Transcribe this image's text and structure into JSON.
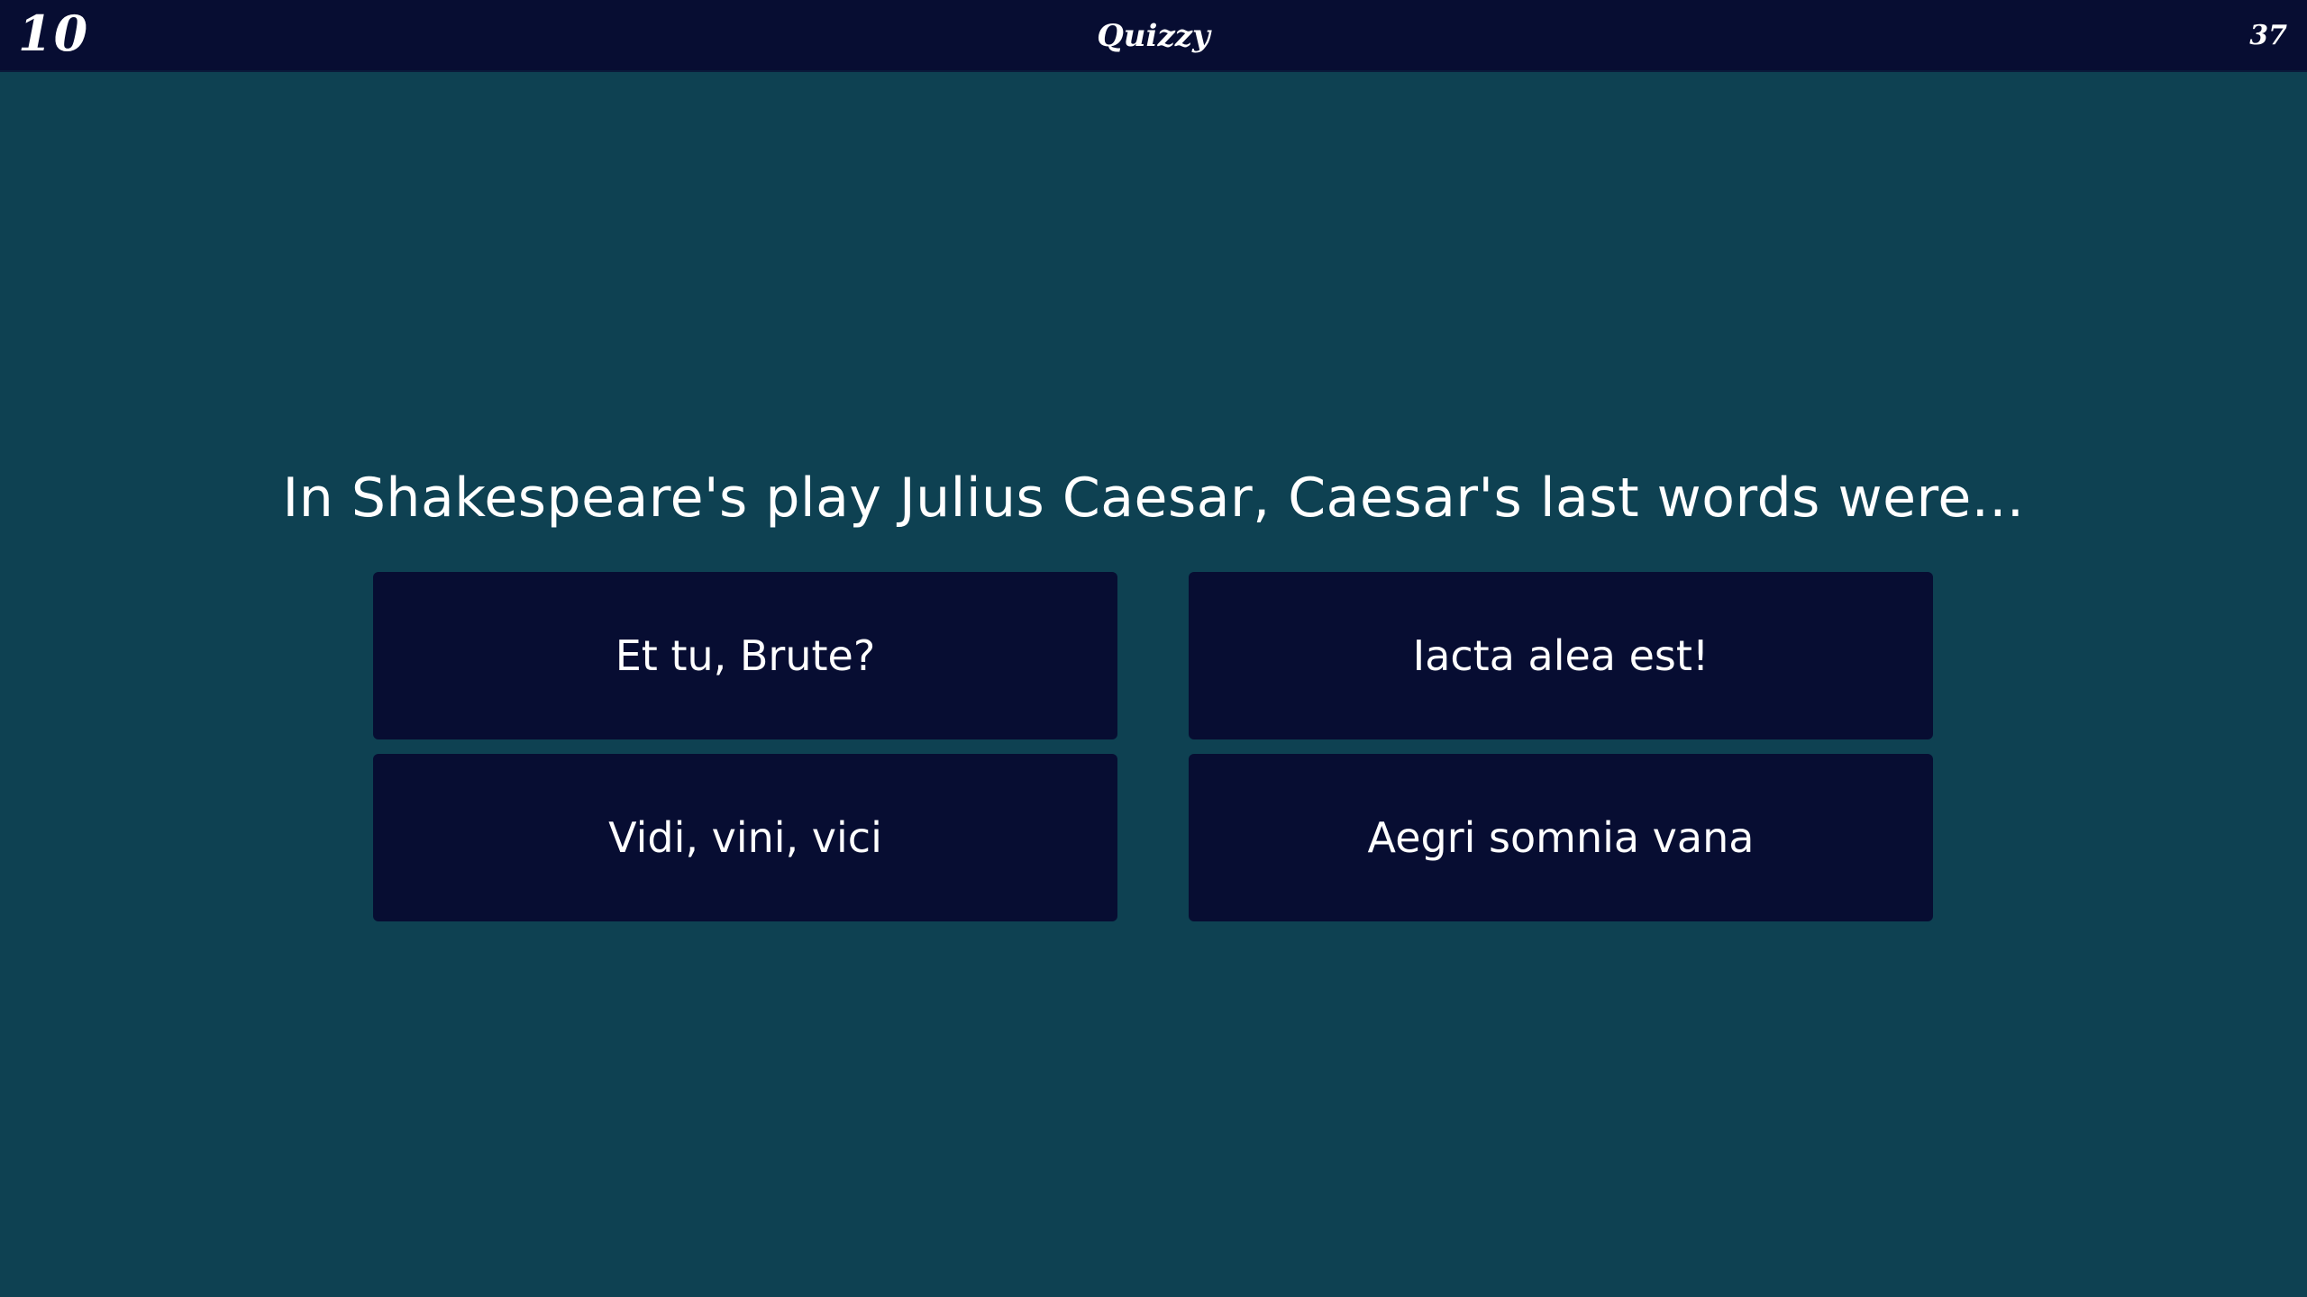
{
  "header": {
    "timer": "10",
    "title": "Quizzy",
    "score": "37"
  },
  "question": {
    "text": "In Shakespeare's play Julius Caesar, Caesar's last words were..."
  },
  "answers": [
    {
      "label": "Et tu, Brute?"
    },
    {
      "label": "Iacta alea est!"
    },
    {
      "label": "Vidi, vini, vici"
    },
    {
      "label": "Aegri somnia vana"
    }
  ],
  "colors": {
    "background": "#0e4152",
    "panel": "#070d32",
    "text": "#ffffff"
  }
}
